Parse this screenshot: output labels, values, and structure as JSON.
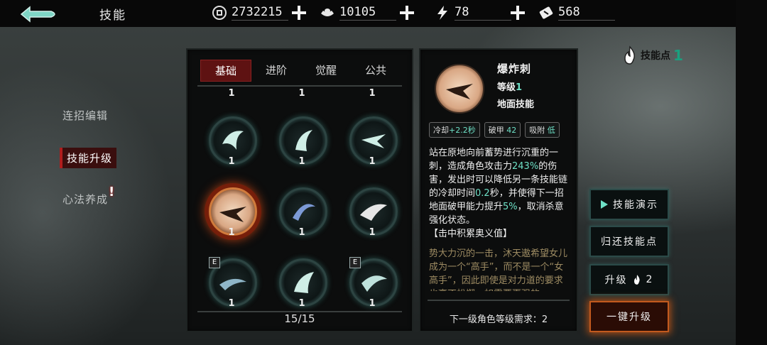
{
  "header": {
    "title": "技能",
    "coins": "2732215",
    "ingots": "10105",
    "energy": "78",
    "tickets": "568"
  },
  "left_menu": {
    "items": [
      "连招编辑",
      "技能升级",
      "心法养成"
    ],
    "active_index": 1,
    "alert": "!"
  },
  "tabs": [
    "基础",
    "进阶",
    "觉醒",
    "公共"
  ],
  "skills": {
    "top_levels": [
      "1",
      "1",
      "1"
    ],
    "levels": [
      "1",
      "1",
      "1",
      "1",
      "1",
      "1",
      "1",
      "1",
      "1"
    ],
    "e_badge": "E",
    "counter": "15/15"
  },
  "detail": {
    "name": "爆炸刺",
    "level_label": "等级",
    "level_value": "1",
    "type": "地面技能",
    "tag1_label": "冷却",
    "tag1_value": "+2.2秒",
    "tag2_label": "破甲",
    "tag2_value": "42",
    "tag3_label": "吸附",
    "tag3_value": "低",
    "desc_p1": "站在原地向前蓄势进行沉重的一刺，造成角色攻击力",
    "desc_h1": "243%",
    "desc_p2": "的伤害，发出时可以降低另一条技能链的冷却时间",
    "desc_h2": "0.2",
    "desc_p3": "秒，并使得下一招地面破甲能力提升",
    "desc_h3": "5%",
    "desc_p4": "，取消杀意强化状态。",
    "desc_p5": "【击中积累奥义值】",
    "lore": "势大力沉的一击，沐天遨希望女儿成为一个“高手”，而不是一个“女高手”，因此即使是对力道的要求也毫不松懈，如需要更强的",
    "requirement": "下一级角色等级需求：2"
  },
  "skill_points": {
    "label": "技能点",
    "value": "1"
  },
  "buttons": {
    "demo": "技能演示",
    "refund": "归还技能点",
    "upgrade": "升级",
    "upgrade_cost": "2",
    "upgrade_all": "一键升级"
  },
  "colors": {
    "accent_teal": "#6ee0c6",
    "accent_red": "#b01d1d",
    "accent_orange": "#c25a1e"
  }
}
